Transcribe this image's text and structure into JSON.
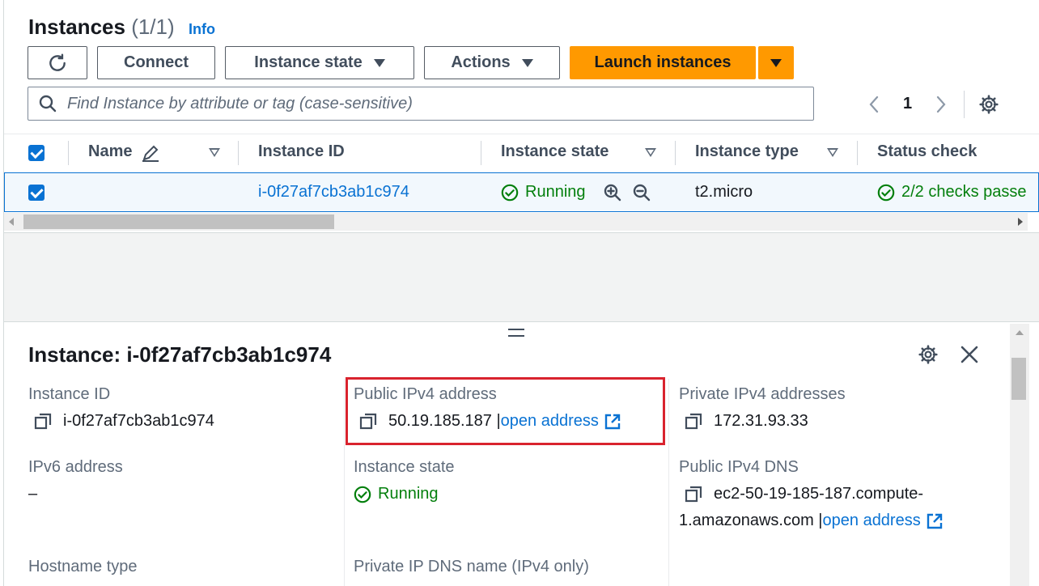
{
  "header": {
    "title": "Instances",
    "count": "(1/1)",
    "info": "Info"
  },
  "toolbar": {
    "connect": "Connect",
    "instance_state": "Instance state",
    "actions": "Actions",
    "launch": "Launch instances"
  },
  "search": {
    "placeholder": "Find Instance by attribute or tag (case-sensitive)"
  },
  "pagination": {
    "page": "1"
  },
  "table": {
    "columns": [
      "Name",
      "Instance ID",
      "Instance state",
      "Instance type",
      "Status check"
    ],
    "rows": [
      {
        "name": "",
        "instance_id": "i-0f27af7cb3ab1c974",
        "state": "Running",
        "type": "t2.micro",
        "status": "2/2 checks passe"
      }
    ]
  },
  "details": {
    "title": "Instance: i-0f27af7cb3ab1c974",
    "instance_id_label": "Instance ID",
    "instance_id": "i-0f27af7cb3ab1c974",
    "public_ipv4_label": "Public IPv4 address",
    "public_ipv4": "50.19.185.187",
    "open_address": "open address",
    "private_ipv4_label": "Private IPv4 addresses",
    "private_ipv4": "172.31.93.33",
    "ipv6_label": "IPv6 address",
    "ipv6": "–",
    "state_label": "Instance state",
    "state": "Running",
    "public_dns_label": "Public IPv4 DNS",
    "public_dns_line1": "ec2-50-19-185-187.compute-",
    "public_dns_line2": "1.amazonaws.com",
    "hostname_label": "Hostname type",
    "private_dns_label": "Private IP DNS name (IPv4 only)"
  },
  "colors": {
    "primary": "#ff9900",
    "link": "#0972d3",
    "success": "#037f0c",
    "highlight": "#d9232e"
  }
}
